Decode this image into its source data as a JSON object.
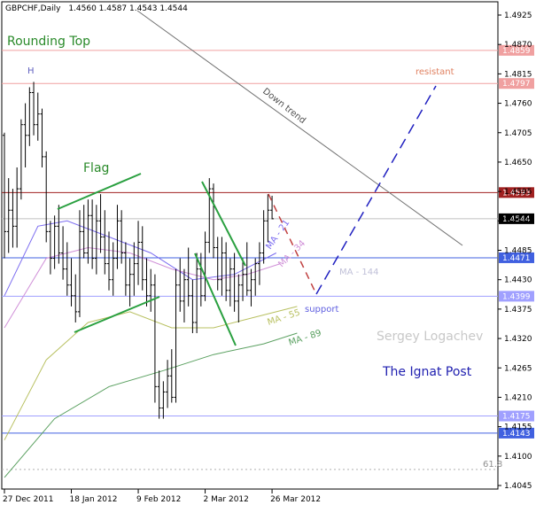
{
  "chart_data": {
    "type": "ohlc",
    "symbol": "GBPCHF,Daily",
    "header_quote": "1.4560 1.4587 1.4543 1.4544",
    "y_range": [
      1.403,
      1.4935
    ],
    "y_ticks": [
      "1.4925",
      "1.4870",
      "1.4815",
      "1.4760",
      "1.4705",
      "1.4650",
      "1.4595",
      "1.4540",
      "1.4485",
      "1.4430",
      "1.4375",
      "1.4320",
      "1.4265",
      "1.4210",
      "1.4155",
      "1.4100",
      "1.4045"
    ],
    "x_ticks": [
      {
        "label": "27 Dec 2011",
        "i": 0
      },
      {
        "label": "18 Jan 2012",
        "i": 16
      },
      {
        "label": "9 Feb 2012",
        "i": 32
      },
      {
        "label": "2 Mar 2012",
        "i": 48
      },
      {
        "label": "26 Mar 2012",
        "i": 64
      }
    ],
    "bars": [
      [
        1.47,
        1.4705,
        1.447,
        1.452
      ],
      [
        1.452,
        1.462,
        1.448,
        1.456
      ],
      [
        1.456,
        1.46,
        1.449,
        1.453
      ],
      [
        1.453,
        1.464,
        1.449,
        1.46
      ],
      [
        1.46,
        1.473,
        1.458,
        1.472
      ],
      [
        1.472,
        1.476,
        1.464,
        1.47
      ],
      [
        1.47,
        1.479,
        1.468,
        1.478
      ],
      [
        1.478,
        1.48,
        1.47,
        1.472
      ],
      [
        1.472,
        1.478,
        1.469,
        1.474
      ],
      [
        1.474,
        1.475,
        1.464,
        1.466
      ],
      [
        1.466,
        1.467,
        1.45,
        1.452
      ],
      [
        1.452,
        1.454,
        1.444,
        1.447
      ],
      [
        1.447,
        1.455,
        1.445,
        1.453
      ],
      [
        1.453,
        1.457,
        1.446,
        1.448
      ],
      [
        1.448,
        1.453,
        1.443,
        1.445
      ],
      [
        1.445,
        1.45,
        1.44,
        1.442
      ],
      [
        1.442,
        1.447,
        1.438,
        1.44
      ],
      [
        1.44,
        1.444,
        1.435,
        1.437
      ],
      [
        1.437,
        1.456,
        1.436,
        1.452
      ],
      [
        1.452,
        1.457,
        1.447,
        1.448
      ],
      [
        1.448,
        1.458,
        1.446,
        1.455
      ],
      [
        1.455,
        1.458,
        1.445,
        1.447
      ],
      [
        1.447,
        1.457,
        1.444,
        1.454
      ],
      [
        1.454,
        1.459,
        1.448,
        1.451
      ],
      [
        1.451,
        1.456,
        1.444,
        1.446
      ],
      [
        1.446,
        1.452,
        1.441,
        1.443
      ],
      [
        1.443,
        1.45,
        1.44,
        1.447
      ],
      [
        1.447,
        1.457,
        1.445,
        1.454
      ],
      [
        1.454,
        1.456,
        1.446,
        1.448
      ],
      [
        1.448,
        1.45,
        1.44,
        1.442
      ],
      [
        1.442,
        1.447,
        1.438,
        1.444
      ],
      [
        1.444,
        1.45,
        1.44,
        1.446
      ],
      [
        1.446,
        1.454,
        1.442,
        1.45
      ],
      [
        1.45,
        1.453,
        1.441,
        1.443
      ],
      [
        1.443,
        1.447,
        1.438,
        1.44
      ],
      [
        1.44,
        1.445,
        1.437,
        1.442
      ],
      [
        1.442,
        1.444,
        1.42,
        1.423
      ],
      [
        1.423,
        1.426,
        1.417,
        1.419
      ],
      [
        1.419,
        1.424,
        1.417,
        1.422
      ],
      [
        1.422,
        1.428,
        1.419,
        1.425
      ],
      [
        1.425,
        1.43,
        1.42,
        1.421
      ],
      [
        1.421,
        1.445,
        1.42,
        1.442
      ],
      [
        1.442,
        1.447,
        1.437,
        1.439
      ],
      [
        1.439,
        1.445,
        1.435,
        1.443
      ],
      [
        1.443,
        1.449,
        1.438,
        1.44
      ],
      [
        1.44,
        1.443,
        1.433,
        1.435
      ],
      [
        1.435,
        1.448,
        1.433,
        1.445
      ],
      [
        1.445,
        1.448,
        1.438,
        1.44
      ],
      [
        1.44,
        1.452,
        1.439,
        1.45
      ],
      [
        1.45,
        1.462,
        1.448,
        1.46
      ],
      [
        1.46,
        1.461,
        1.447,
        1.449
      ],
      [
        1.449,
        1.451,
        1.441,
        1.443
      ],
      [
        1.443,
        1.451,
        1.44,
        1.448
      ],
      [
        1.448,
        1.45,
        1.439,
        1.441
      ],
      [
        1.441,
        1.447,
        1.438,
        1.445
      ],
      [
        1.445,
        1.448,
        1.437,
        1.439
      ],
      [
        1.439,
        1.444,
        1.435,
        1.442
      ],
      [
        1.442,
        1.447,
        1.439,
        1.444
      ],
      [
        1.444,
        1.45,
        1.44,
        1.441
      ],
      [
        1.441,
        1.445,
        1.438,
        1.443
      ],
      [
        1.443,
        1.447,
        1.44,
        1.446
      ],
      [
        1.446,
        1.45,
        1.442,
        1.448
      ],
      [
        1.448,
        1.456,
        1.446,
        1.454
      ],
      [
        1.454,
        1.459,
        1.45,
        1.456
      ],
      [
        1.456,
        1.4587,
        1.4543,
        1.4544
      ]
    ],
    "moving_averages": [
      {
        "name": "MA - 21",
        "color": "#7b6cf0",
        "values": [
          [
            0,
            1.44
          ],
          [
            8,
            1.453
          ],
          [
            15,
            1.454
          ],
          [
            25,
            1.451
          ],
          [
            35,
            1.448
          ],
          [
            45,
            1.443
          ],
          [
            55,
            1.444
          ],
          [
            65,
            1.448
          ]
        ]
      },
      {
        "name": "MA - 34",
        "color": "#d090d8",
        "values": [
          [
            0,
            1.434
          ],
          [
            10,
            1.447
          ],
          [
            20,
            1.449
          ],
          [
            30,
            1.448
          ],
          [
            40,
            1.445
          ],
          [
            50,
            1.443
          ],
          [
            58,
            1.444
          ],
          [
            66,
            1.446
          ]
        ]
      },
      {
        "name": "MA - 55",
        "color": "#b8c060",
        "values": [
          [
            0,
            1.413
          ],
          [
            10,
            1.428
          ],
          [
            20,
            1.435
          ],
          [
            30,
            1.437
          ],
          [
            40,
            1.434
          ],
          [
            50,
            1.434
          ],
          [
            60,
            1.436
          ],
          [
            70,
            1.438
          ]
        ]
      },
      {
        "name": "MA - 89",
        "color": "#5aa060",
        "values": [
          [
            0,
            1.406
          ],
          [
            12,
            1.417
          ],
          [
            25,
            1.423
          ],
          [
            38,
            1.426
          ],
          [
            50,
            1.429
          ],
          [
            62,
            1.431
          ],
          [
            70,
            1.433
          ]
        ]
      },
      {
        "name": "MA - 144",
        "color": "#c0c0d8",
        "values": []
      }
    ],
    "h_lines": [
      {
        "value": 1.4859,
        "color": "#f0a0a0",
        "label": "1.4859"
      },
      {
        "value": 1.4797,
        "color": "#f0a0a0",
        "label": "1.4797"
      },
      {
        "value": 1.4593,
        "color": "#a02020",
        "label": "1.4593"
      },
      {
        "value": 1.4544,
        "color": "#c0c0c0",
        "label": "1.4544"
      },
      {
        "value": 1.4471,
        "color": "#4060e0",
        "label": "1.4471"
      },
      {
        "value": 1.4399,
        "color": "#a0a0ff",
        "label": "1.4399"
      },
      {
        "value": 1.4175,
        "color": "#a0a0ff",
        "label": "1.4175"
      },
      {
        "value": 1.4143,
        "color": "#4060e0",
        "label": "1.4143"
      }
    ],
    "fib_label": "61.8",
    "annotations": {
      "rounding_top": "Rounding Top",
      "flag": "Flag",
      "down_trend": "Down trend",
      "resistant": "resistant",
      "support": "support",
      "h_marker": "H",
      "author": "Sergey Logachev",
      "brand": "The Ignat Post"
    },
    "colors": {
      "bars": "#000000",
      "flag": "#2aa040",
      "trend": "#707070",
      "projection_red": "#c04040",
      "projection_blue": "#2020c0",
      "brand": "#2020b0",
      "title": "#2a8a2a"
    }
  }
}
